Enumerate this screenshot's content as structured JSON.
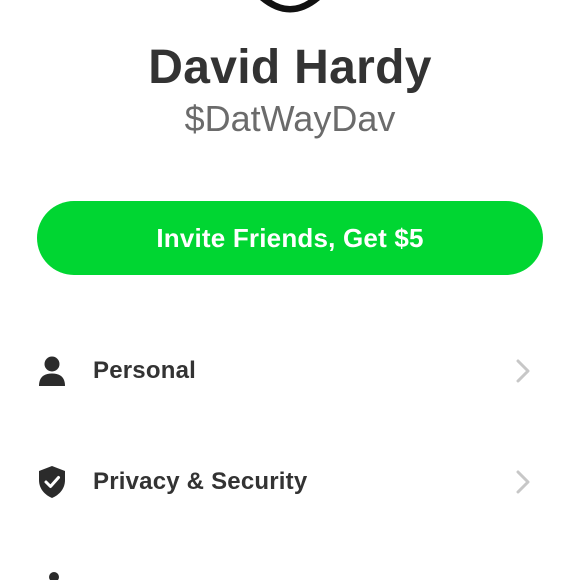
{
  "profile": {
    "name": "David Hardy",
    "cashtag": "$DatWayDav"
  },
  "invite": {
    "label": "Invite Friends, Get $5",
    "color": "#00d632"
  },
  "menu": {
    "items": [
      {
        "label": "Personal",
        "icon": "person-icon",
        "chevron": "chevron-right-icon"
      },
      {
        "label": "Privacy & Security",
        "icon": "shield-check-icon",
        "chevron": "chevron-right-icon"
      }
    ]
  },
  "colors": {
    "text_primary": "#333333",
    "text_secondary": "#6b6b6b",
    "chevron": "#c7c7c7",
    "background": "#ffffff"
  }
}
